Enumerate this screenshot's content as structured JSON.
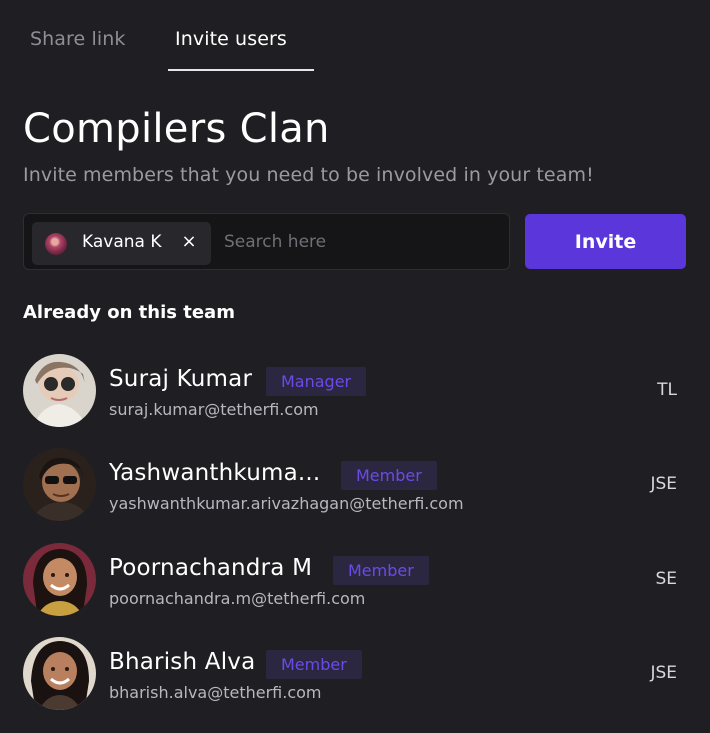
{
  "tabs": [
    {
      "label": "Share link",
      "active": false
    },
    {
      "label": "Invite users",
      "active": true
    }
  ],
  "team": {
    "name": "Compilers Clan",
    "subtitle": "Invite members that you need to be involved in your team!"
  },
  "invite": {
    "chip_name": "Kavana K",
    "chip_close": "×",
    "search_placeholder": "Search here",
    "button_label": "Invite"
  },
  "members_heading": "Already on this team",
  "members": [
    {
      "name": "Suraj Kumar",
      "role": "Manager",
      "email": "suraj.kumar@tetherfi.com",
      "code": "TL"
    },
    {
      "name": "Yashwanthkuma...",
      "role": "Member",
      "email": "yashwanthkumar.arivazhagan@tetherfi.com",
      "code": "JSE"
    },
    {
      "name": "Poornachandra M",
      "role": "Member",
      "email": "poornachandra.m@tetherfi.com",
      "code": "SE"
    },
    {
      "name": "Bharish Alva",
      "role": "Member",
      "email": "bharish.alva@tetherfi.com",
      "code": "JSE"
    }
  ],
  "colors": {
    "background": "#1f1f23",
    "accent": "#5b37db",
    "role_badge_bg": "#2b2740",
    "role_badge_text": "#6b4be8"
  }
}
